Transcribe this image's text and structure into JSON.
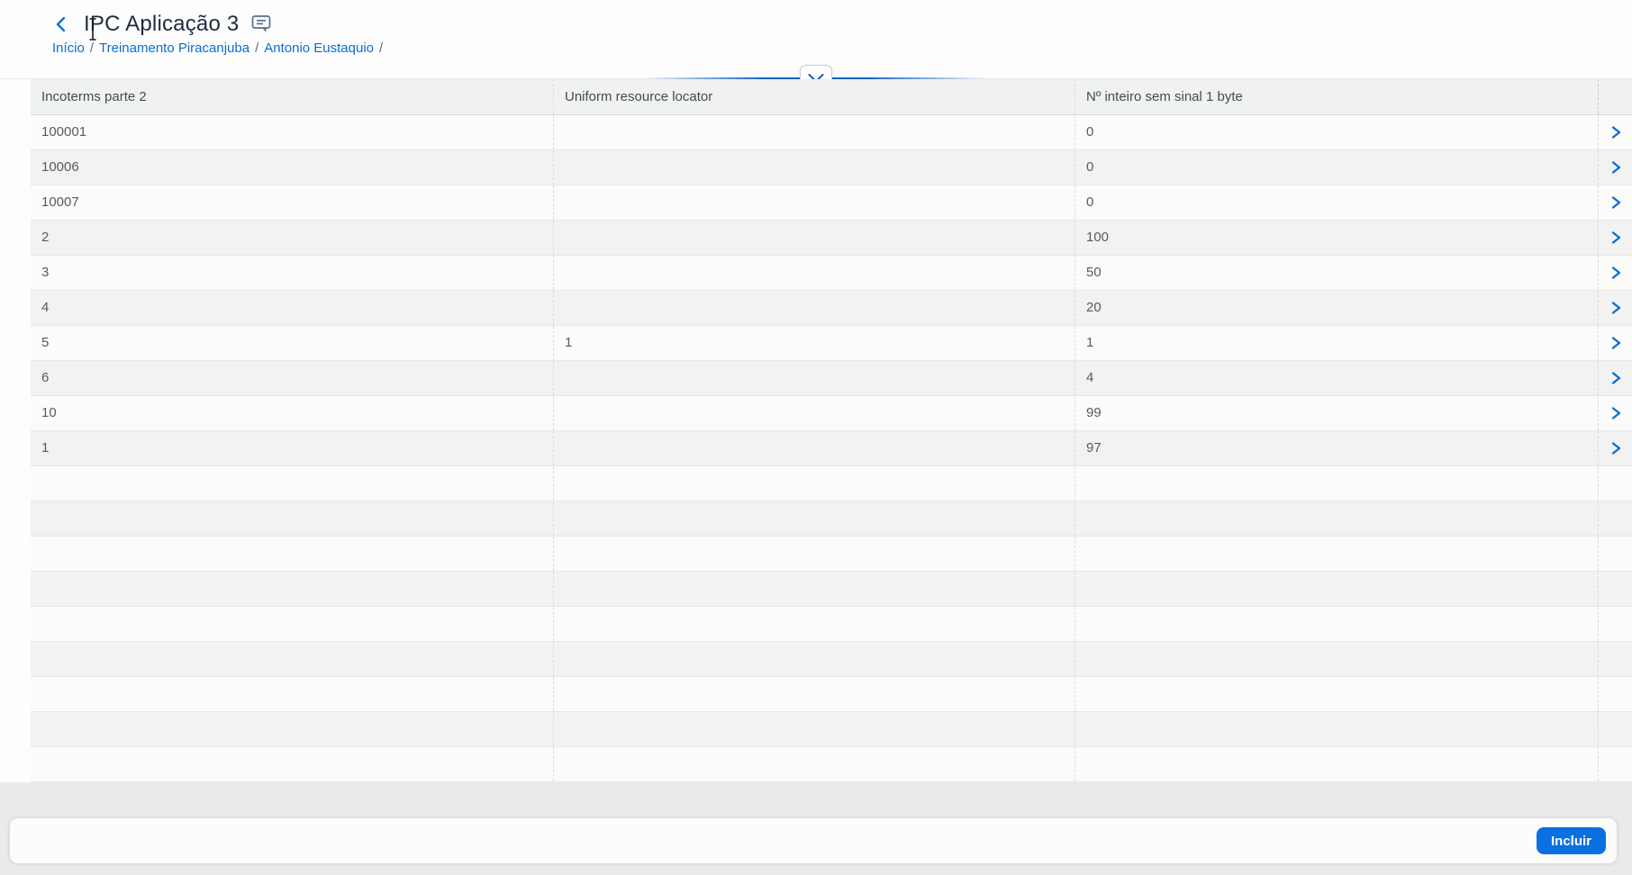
{
  "app": {
    "title": "IPC Aplicação 3"
  },
  "breadcrumb": {
    "separator": "/",
    "items": [
      "Início",
      "Treinamento Piracanjuba",
      "Antonio Eustaquio"
    ]
  },
  "table": {
    "columns": [
      "Incoterms parte 2",
      "Uniform resource locator",
      "Nº inteiro sem sinal 1 byte"
    ],
    "rows": [
      {
        "c1": "100001",
        "c2": "",
        "c3": "0"
      },
      {
        "c1": "10006",
        "c2": "",
        "c3": "0"
      },
      {
        "c1": "10007",
        "c2": "",
        "c3": "0"
      },
      {
        "c1": "2",
        "c2": "",
        "c3": "100"
      },
      {
        "c1": "3",
        "c2": "",
        "c3": "50"
      },
      {
        "c1": "4",
        "c2": "",
        "c3": "20"
      },
      {
        "c1": "5",
        "c2": "1",
        "c3": "1"
      },
      {
        "c1": "6",
        "c2": "",
        "c3": "4"
      },
      {
        "c1": "10",
        "c2": "",
        "c3": "99"
      },
      {
        "c1": "1",
        "c2": "",
        "c3": "97"
      }
    ],
    "empty_row_count": 9
  },
  "footer": {
    "incluir_button": "Incluir"
  },
  "colors": {
    "link_blue": "#0a6ed1",
    "accent_rule_blue": "#1263c0",
    "button_blue": "#0a70e2",
    "title_text": "#1d2d3e",
    "header_text": "#454b52",
    "cell_text": "#565c61",
    "header_row_bg": "#f0f1f1",
    "row_even_bg": "#f1f2f1",
    "row_odd_bg": "#fbfbfa",
    "page_bottom_bg": "#e9eae9"
  }
}
